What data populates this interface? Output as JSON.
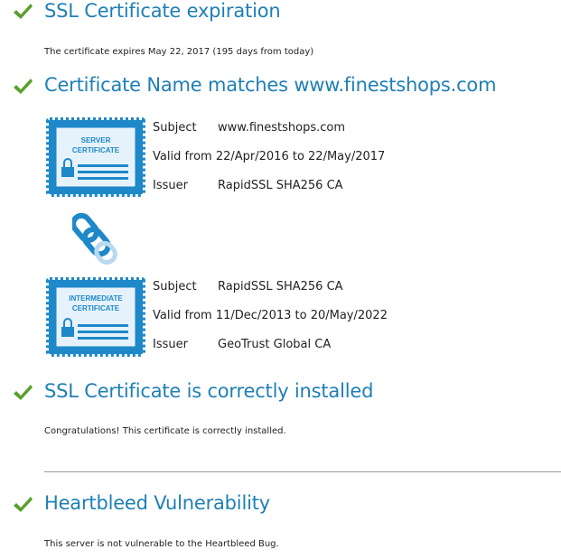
{
  "colors": {
    "accent": "#1f7fb6",
    "check": "#5aa02c",
    "badge": "#1e88c9"
  },
  "sections": {
    "expiration": {
      "title": "SSL Certificate expiration",
      "description": "The certificate expires May 22, 2017 (195 days from today)"
    },
    "name_match": {
      "title": "Certificate Name matches www.finestshops.com"
    },
    "installed": {
      "title": "SSL Certificate is correctly installed",
      "description": "Congratulations! This certificate is correctly installed."
    },
    "heartbleed": {
      "title": "Heartbleed Vulnerability",
      "description": "This server is not vulnerable to the Heartbleed Bug."
    }
  },
  "server_cert": {
    "badge_line1": "SERVER",
    "badge_line2": "CERTIFICATE",
    "subject_label": "Subject",
    "subject_value": "www.finestshops.com",
    "valid_text": "Valid from 22/Apr/2016 to 22/May/2017",
    "issuer_label": "Issuer",
    "issuer_value": "RapidSSL SHA256 CA"
  },
  "intermediate_cert": {
    "badge_line1": "INTERMEDIATE",
    "badge_line2": "CERTIFICATE",
    "subject_label": "Subject",
    "subject_value": "RapidSSL SHA256 CA",
    "valid_text": "Valid from 11/Dec/2013 to 20/May/2022",
    "issuer_label": "Issuer",
    "issuer_value": "GeoTrust Global CA"
  }
}
